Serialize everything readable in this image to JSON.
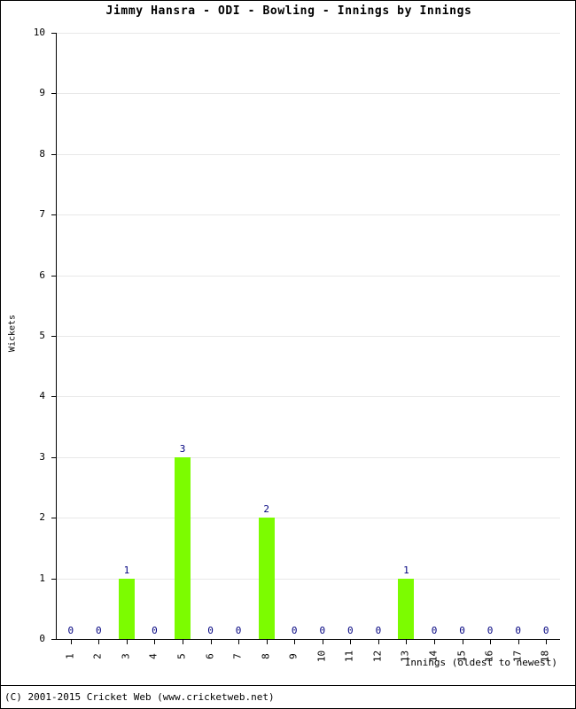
{
  "chart_data": {
    "type": "bar",
    "title": "Jimmy Hansra - ODI - Bowling - Innings by Innings",
    "xlabel": "Innings (oldest to newest)",
    "ylabel": "Wickets",
    "categories": [
      "1",
      "2",
      "3",
      "4",
      "5",
      "6",
      "7",
      "8",
      "9",
      "10",
      "11",
      "12",
      "13",
      "14",
      "15",
      "16",
      "17",
      "18"
    ],
    "values": [
      0,
      0,
      1,
      0,
      3,
      0,
      0,
      2,
      0,
      0,
      0,
      0,
      1,
      0,
      0,
      0,
      0,
      0
    ],
    "value_labels": [
      "0",
      "0",
      "1",
      "0",
      "3",
      "0",
      "0",
      "2",
      "0",
      "0",
      "0",
      "0",
      "1",
      "0",
      "0",
      "0",
      "0",
      "0"
    ],
    "ylim": [
      0,
      10
    ],
    "yticks": [
      "0",
      "1",
      "2",
      "3",
      "4",
      "5",
      "6",
      "7",
      "8",
      "9",
      "10"
    ],
    "grid": true,
    "legend": "none",
    "bar_color": "#7cfc00",
    "label_color": "#00007f",
    "gridline_color": "#e8e8e8",
    "axis_color": "#000000"
  },
  "footer": {
    "copyright": "(C) 2001-2015 Cricket Web (www.cricketweb.net)"
  }
}
